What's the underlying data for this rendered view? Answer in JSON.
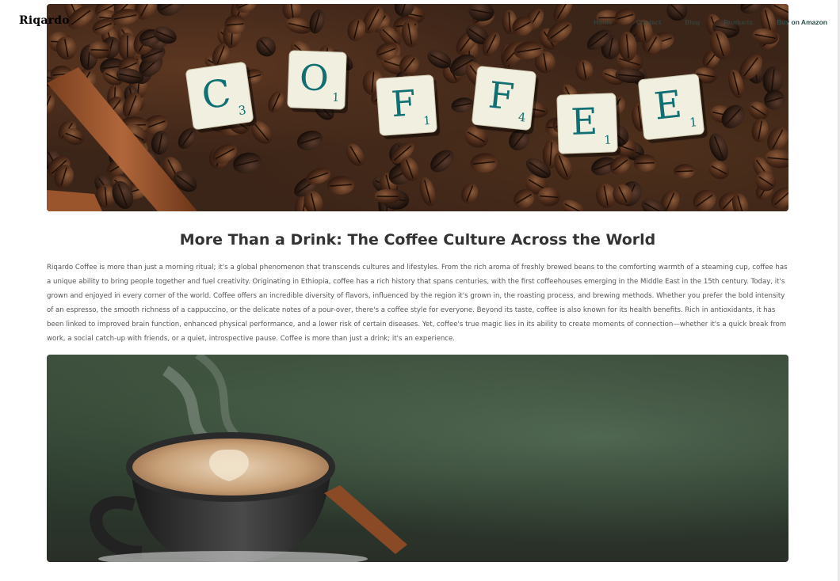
{
  "brand": {
    "name": "Riqardo"
  },
  "nav": {
    "items": [
      "Home",
      "Contact",
      "Blog",
      "Products"
    ],
    "cta": "Buy on Amazon"
  },
  "hero": {
    "image_alt": "COFFEE letter tiles on coffee beans",
    "tiles": [
      {
        "letter": "C",
        "score": "3"
      },
      {
        "letter": "O",
        "score": "1"
      },
      {
        "letter": "F",
        "score": "1"
      },
      {
        "letter": "F",
        "score": "4"
      },
      {
        "letter": "E",
        "score": "1"
      },
      {
        "letter": "E",
        "score": "1"
      }
    ]
  },
  "article": {
    "title": "More Than a Drink: The Coffee Culture Across the World",
    "body": "Riqardo Coffee is more than just a morning ritual; it's a global phenomenon that transcends cultures and lifestyles. From the rich aroma of freshly brewed beans to the comforting warmth of a steaming cup, coffee has a unique ability to bring people together and fuel creativity. Originating in Ethiopia, coffee has a rich history that spans centuries, with the first coffeehouses emerging in the Middle East in the 15th century. Today, it's grown and enjoyed in every corner of the world. Coffee offers an incredible diversity of flavors, influenced by the region it's grown in, the roasting process, and brewing methods. Whether you prefer the bold intensity of an espresso, the smooth richness of a cappuccino, or the delicate notes of a pour-over, there's a coffee style for everyone. Beyond its taste, coffee is also known for its health benefits. Rich in antioxidants, it has been linked to improved brain function, enhanced physical performance, and a lower risk of certain diseases. Yet, coffee's true magic lies in its ability to create moments of connection—whether it's a quick break from work, a social catch-up with friends, or a quiet, introspective pause. Coffee is more than just a drink; it's an experience."
  },
  "photo": {
    "image_alt": "Cappuccino with latte art and cinnamon stick"
  },
  "colors": {
    "accent": "#2a4f4a",
    "tile_text": "#0f6f72",
    "tile_face": "#f1efe0"
  }
}
